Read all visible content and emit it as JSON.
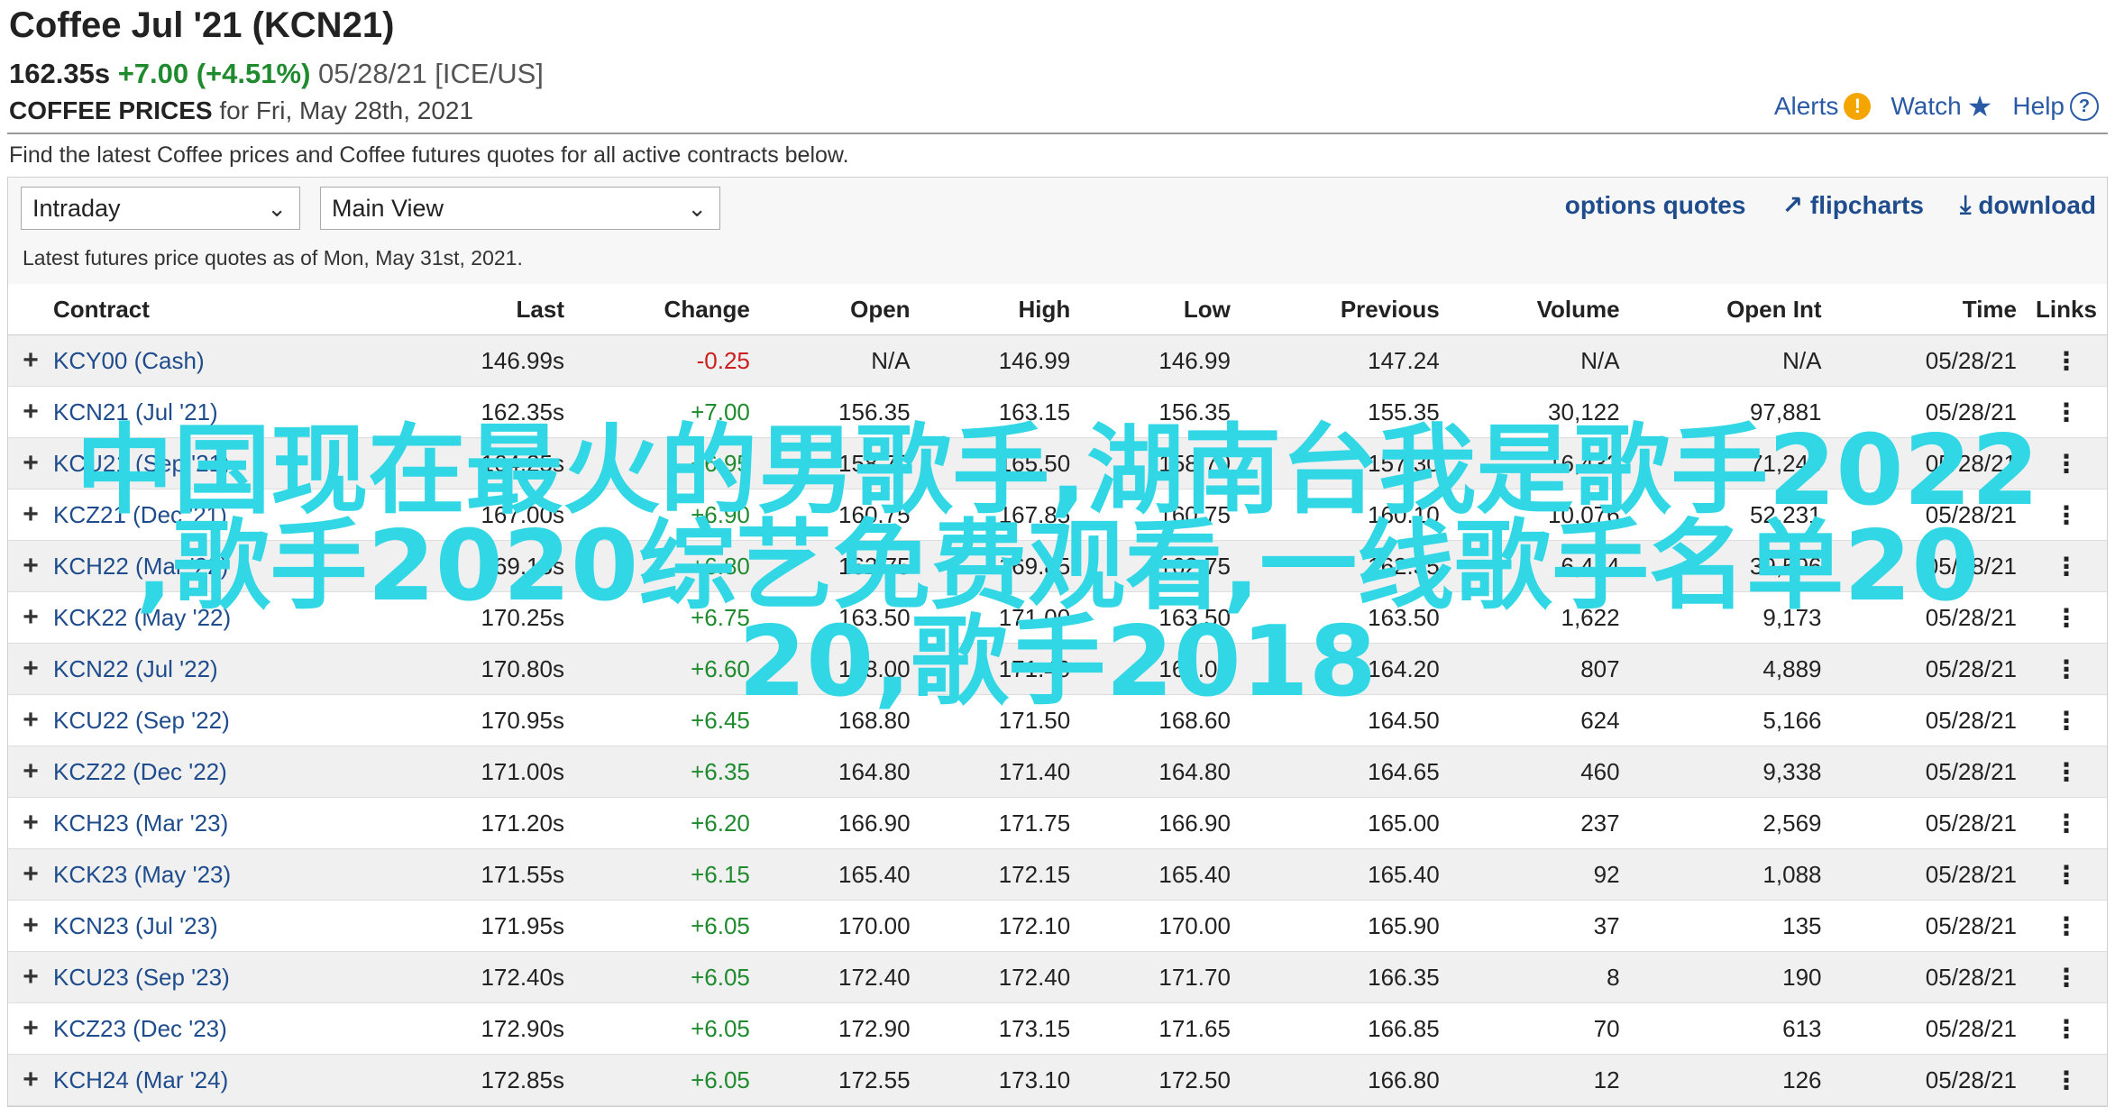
{
  "header": {
    "title": "Coffee Jul '21 (KCN21)",
    "last": "162.35s",
    "change": "+7.00 (+4.51%)",
    "date_exchange": "05/28/21 [ICE/US]",
    "prices_label": "COFFEE PRICES",
    "prices_date": "for Fri, May 28th, 2021",
    "tools": {
      "alerts": "Alerts",
      "watch": "Watch",
      "help": "Help"
    },
    "subtitle": "Find the latest Coffee prices and Coffee futures quotes for all active contracts below."
  },
  "controls": {
    "interval": "Intraday",
    "view": "Main View",
    "actions": {
      "options": "options quotes",
      "flipcharts": "flipcharts",
      "download": "download"
    },
    "as_of": "Latest futures price quotes as of Mon, May 31st, 2021."
  },
  "table": {
    "columns": [
      "Contract",
      "Last",
      "Change",
      "Open",
      "High",
      "Low",
      "Previous",
      "Volume",
      "Open Int",
      "Time",
      "Links"
    ],
    "rows": [
      [
        "KCY00 (Cash)",
        "146.99s",
        "-0.25",
        "N/A",
        "146.99",
        "146.99",
        "147.24",
        "N/A",
        "N/A",
        "05/28/21"
      ],
      [
        "KCN21 (Jul '21)",
        "162.35s",
        "+7.00",
        "156.35",
        "163.15",
        "156.35",
        "155.35",
        "30,122",
        "97,881",
        "05/28/21"
      ],
      [
        "KCU21 (Sep '21)",
        "164.25s",
        "+6.95",
        "158.70",
        "165.50",
        "158.70",
        "157.30",
        "16,432",
        "71,245",
        "05/28/21"
      ],
      [
        "KCZ21 (Dec '21)",
        "167.00s",
        "+6.90",
        "160.75",
        "167.85",
        "160.75",
        "160.10",
        "10,076",
        "52,231",
        "05/28/21"
      ],
      [
        "KCH22 (Mar '22)",
        "169.15s",
        "+6.80",
        "162.75",
        "169.85",
        "162.75",
        "162.35",
        "6,414",
        "39,596",
        "05/28/21"
      ],
      [
        "KCK22 (May '22)",
        "170.25s",
        "+6.75",
        "163.50",
        "171.00",
        "163.50",
        "163.50",
        "1,622",
        "9,173",
        "05/28/21"
      ],
      [
        "KCN22 (Jul '22)",
        "170.80s",
        "+6.60",
        "168.00",
        "171.40",
        "168.00",
        "164.20",
        "807",
        "4,889",
        "05/28/21"
      ],
      [
        "KCU22 (Sep '22)",
        "170.95s",
        "+6.45",
        "168.80",
        "171.50",
        "168.60",
        "164.50",
        "624",
        "5,166",
        "05/28/21"
      ],
      [
        "KCZ22 (Dec '22)",
        "171.00s",
        "+6.35",
        "164.80",
        "171.40",
        "164.80",
        "164.65",
        "460",
        "9,338",
        "05/28/21"
      ],
      [
        "KCH23 (Mar '23)",
        "171.20s",
        "+6.20",
        "166.90",
        "171.75",
        "166.90",
        "165.00",
        "237",
        "2,569",
        "05/28/21"
      ],
      [
        "KCK23 (May '23)",
        "171.55s",
        "+6.15",
        "165.40",
        "172.15",
        "165.40",
        "165.40",
        "92",
        "1,088",
        "05/28/21"
      ],
      [
        "KCN23 (Jul '23)",
        "171.95s",
        "+6.05",
        "170.00",
        "172.10",
        "170.00",
        "165.90",
        "37",
        "135",
        "05/28/21"
      ],
      [
        "KCU23 (Sep '23)",
        "172.40s",
        "+6.05",
        "172.40",
        "172.40",
        "171.70",
        "166.35",
        "8",
        "190",
        "05/28/21"
      ],
      [
        "KCZ23 (Dec '23)",
        "172.90s",
        "+6.05",
        "172.90",
        "173.15",
        "171.65",
        "166.85",
        "70",
        "613",
        "05/28/21"
      ],
      [
        "KCH24 (Mar '24)",
        "172.85s",
        "+6.05",
        "172.55",
        "173.10",
        "172.50",
        "166.80",
        "12",
        "126",
        "05/28/21"
      ]
    ]
  },
  "overlay": {
    "line1": "中国现在最火的男歌手,湖南台我是歌手2022",
    "line2": ",歌手2020综艺免费观看,一线歌手名单20",
    "line3": "20,歌手2018"
  },
  "colors": {
    "positive": "#1f8b2e",
    "negative": "#cc1f1f",
    "link": "#1f4c8c",
    "overlay": "#31d7e5"
  },
  "icons": {
    "alerts": "alert-icon",
    "watch": "star-icon",
    "help": "help-icon",
    "expand": "plus-icon",
    "links": "kebab-icon",
    "select": "chevron-down-icon"
  }
}
